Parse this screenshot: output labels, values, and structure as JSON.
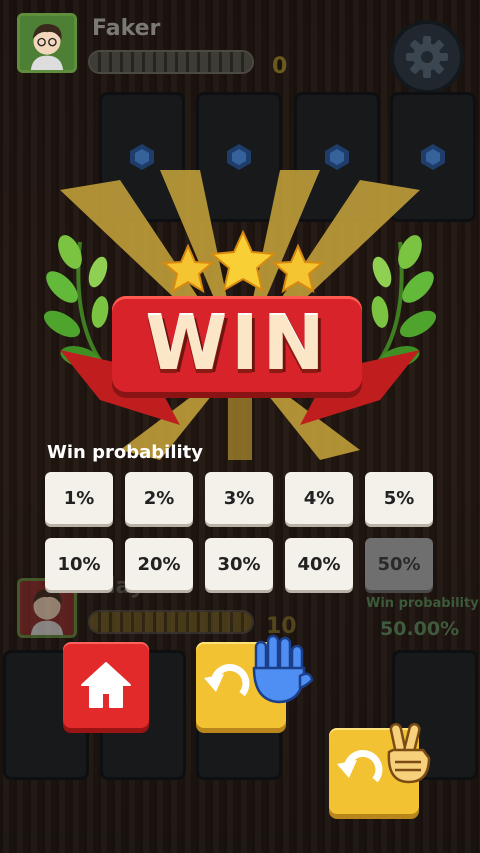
{
  "opponent": {
    "name": "Faker",
    "score": "0"
  },
  "banner": {
    "title": "WIN"
  },
  "probability": {
    "label": "Win probability",
    "options": [
      "1%",
      "2%",
      "3%",
      "4%",
      "5%",
      "10%",
      "20%",
      "30%",
      "40%",
      "50%"
    ],
    "selected": "50%"
  },
  "player": {
    "name": "Player",
    "score": "10",
    "prob_label": "Win probability",
    "prob_value": "50.00%"
  },
  "buttons": {
    "home": "home-icon",
    "retry_paper": "undo-paper-icon",
    "retry_scissors": "undo-scissors-icon"
  },
  "colors": {
    "win_red": "#d8232a",
    "win_gold": "#f5c531",
    "leaf_green": "#63b93a",
    "button_red": "#e22a2a",
    "button_yellow": "#f3c233"
  }
}
